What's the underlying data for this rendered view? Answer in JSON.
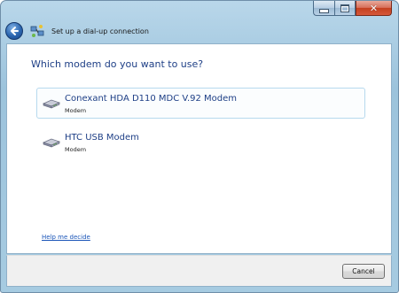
{
  "window": {
    "title": "Set up a dial-up connection",
    "controls": {
      "minimize": "minimize",
      "maximize": "maximize",
      "close": "close"
    }
  },
  "header": {
    "back_icon": "back-arrow-icon",
    "app_icon": "network-connection-icon"
  },
  "main": {
    "question": "Which modem do you want to use?",
    "modems": [
      {
        "name": "Conexant HDA D110 MDC V.92 Modem",
        "type": "Modem",
        "icon": "modem-icon",
        "selected": true
      },
      {
        "name": "HTC USB Modem",
        "type": "Modem",
        "icon": "modem-icon",
        "selected": false
      }
    ],
    "help_link": "Help me decide"
  },
  "footer": {
    "cancel_label": "Cancel"
  },
  "colors": {
    "accent_text": "#1e3f86",
    "link": "#1a55b8",
    "frame": "#a6cbe1",
    "selection_border": "#b7d9ee"
  }
}
